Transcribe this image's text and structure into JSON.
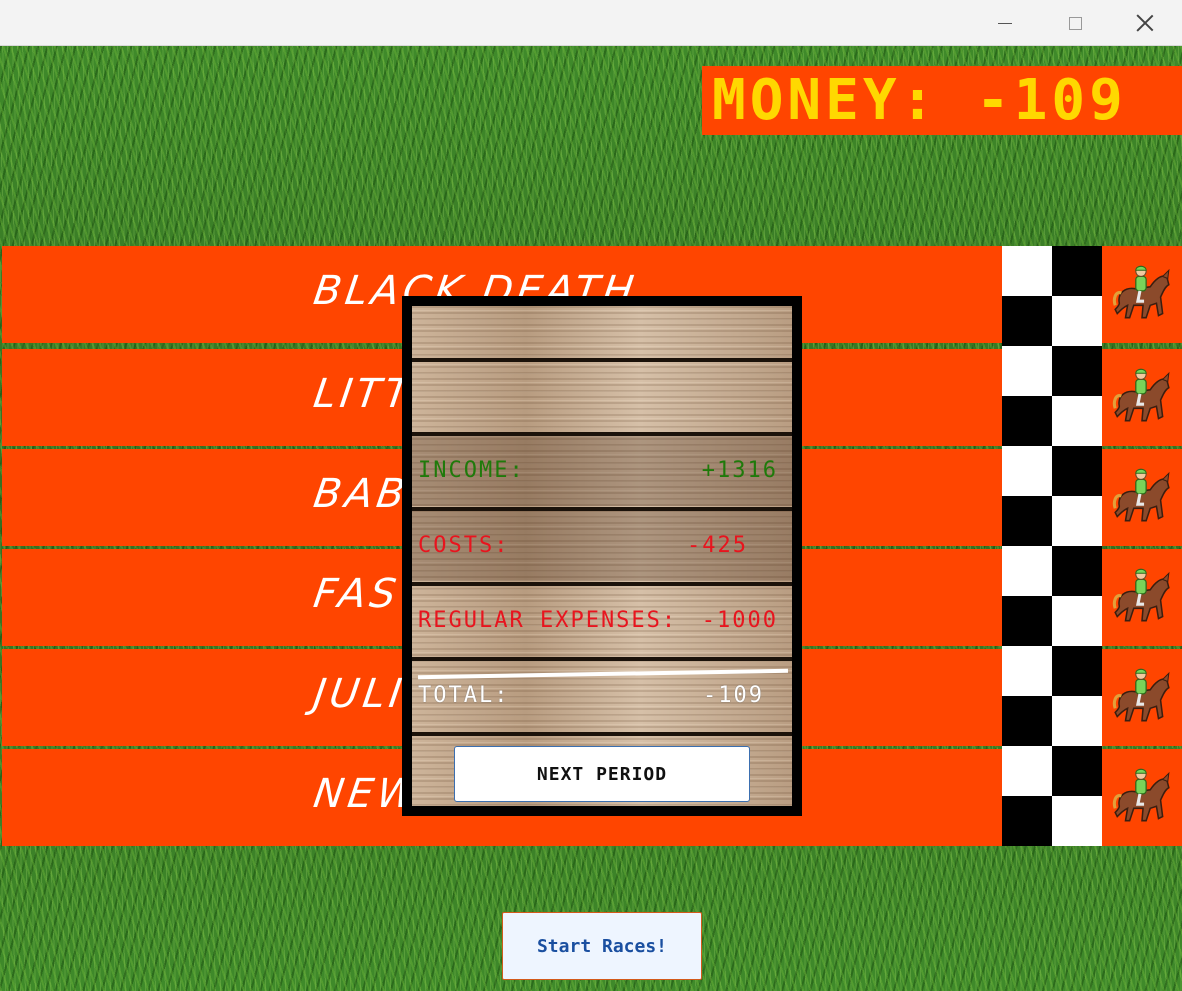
{
  "window": {
    "minimize": "—",
    "maximize": "☐",
    "close": "✕"
  },
  "money": {
    "text": "MONEY: -109"
  },
  "lanes": [
    {
      "name": "BLACK DEATH"
    },
    {
      "name": "LITT"
    },
    {
      "name": "BABY"
    },
    {
      "name": "FAST"
    },
    {
      "name": "JULI"
    },
    {
      "name": "NEW"
    }
  ],
  "summary": {
    "income_label": "INCOME:",
    "income_value": "+1316",
    "costs_label": "COSTS:",
    "costs_value": "-425",
    "expenses_label": "REGULAR EXPENSES:",
    "expenses_value": "-1000",
    "total_label": "TOTAL:",
    "total_value": "-109",
    "next_label": "NEXT PERIOD"
  },
  "start_button": {
    "label": "Start Races!"
  },
  "colors": {
    "lane": "#ff4500",
    "money_text": "#ffd800",
    "income": "#1f7a0a",
    "costs": "#e8141e",
    "total": "#ffffff"
  },
  "icons": {
    "horse": "horse-racing-icon",
    "checker": "finish-line-checker"
  }
}
